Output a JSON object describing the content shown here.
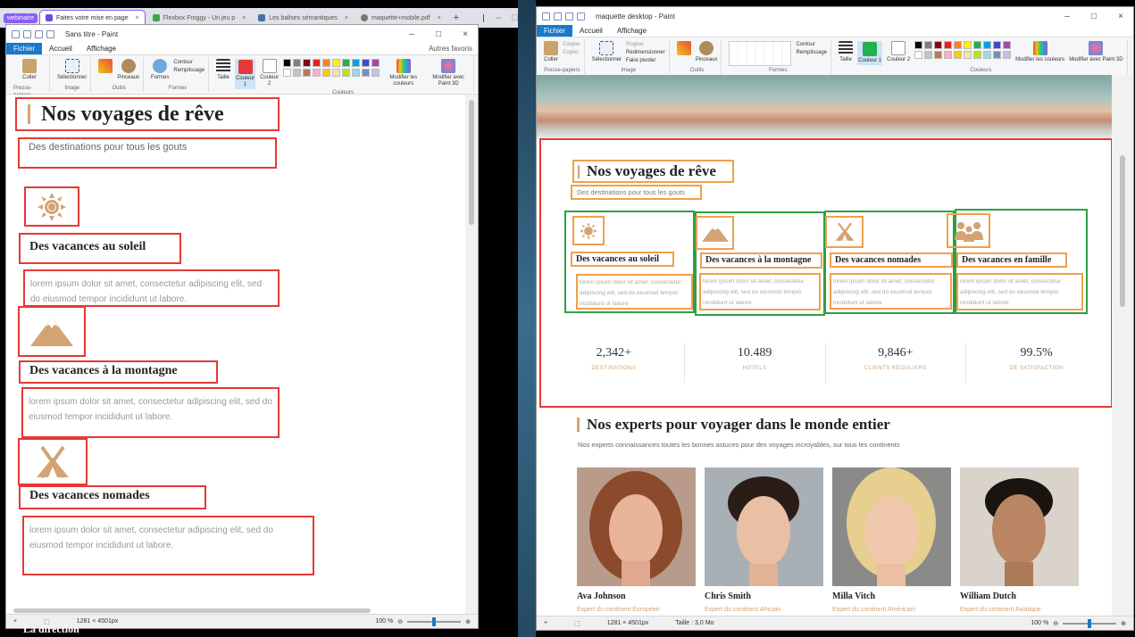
{
  "left": {
    "browser_tabs": [
      {
        "label": "webinaire",
        "active": false
      },
      {
        "label": "Faites votre mise en page",
        "active": true
      },
      {
        "label": "Flexbox Froggy - Un jeu p",
        "active": false
      },
      {
        "label": "Les balises sémantiques",
        "active": false
      },
      {
        "label": "maquette+mobile.pdf",
        "active": false
      }
    ],
    "window_title": "Sans titre - Paint",
    "menu": [
      "Fichier",
      "Accueil",
      "Affichage"
    ],
    "ribbon_groups": [
      "Presse-papiers",
      "Image",
      "Outils",
      "Formes",
      "Couleurs"
    ],
    "ribbon_items": {
      "coller": "Coller",
      "selectionner": "Sélectionner",
      "pinceaux": "Pinceaux",
      "formes": "Formes",
      "contour": "Contour",
      "remplissage": "Remplissage",
      "taille": "Taille",
      "couleur1": "Couleur 1",
      "couleur2": "Couleur 2",
      "modifier_couleurs": "Modifier les couleurs",
      "paint3d": "Modifier avec Paint 3D"
    },
    "bookmark": "Autres favoris",
    "canvas": {
      "title": "Nos voyages de rêve",
      "subtitle": "Des destinations pour tous les gouts",
      "sections": [
        {
          "heading": "Des vacances au soleil",
          "icon": "sun-icon",
          "text": "lorem ipsum dolor sit amet, consectetur adipiscing elit, sed do eiusmod tempor incididunt ut labore."
        },
        {
          "heading": "Des vacances à la montagne",
          "icon": "mountain-icon",
          "text": "lorem ipsum dolor sit amet, consectetur adipiscing elit, sed do eiusmod tempor incididunt ut labore."
        },
        {
          "heading": "Des vacances nomades",
          "icon": "tent-icon",
          "text": "lorem ipsum dolor sit amet, consectetur adipiscing elit, sed do eiusmod tempor incididunt ut labore."
        }
      ]
    },
    "status": {
      "dimensions": "1281 × 4501px",
      "zoom": "100 %"
    }
  },
  "right": {
    "window_title": "maquette desktop - Paint",
    "menu": [
      "Fichier",
      "Accueil",
      "Affichage"
    ],
    "ribbon_groups": [
      "Presse-papiers",
      "Image",
      "Outils",
      "Formes",
      "Couleurs"
    ],
    "ribbon_items": {
      "coller": "Coller",
      "couper": "Couper",
      "copier": "Copier",
      "selectionner": "Sélectionner",
      "rogner": "Rogner",
      "redimensionner": "Redimensionner",
      "faire_pivoter": "Faire pivoter",
      "pinceaux": "Pinceaux",
      "contour": "Contour",
      "remplissage": "Remplissage",
      "taille": "Taille",
      "couleur1": "Couleur 1",
      "couleur2": "Couleur 2",
      "modifier_couleurs": "Modifier les couleurs",
      "paint3d": "Modifier avec Paint 3D"
    },
    "canvas": {
      "title": "Nos voyages de rêve",
      "subtitle": "Des destinations pour tous les gouts",
      "cards": [
        {
          "heading": "Des vacances au soleil",
          "icon": "sun-icon",
          "text": "lorem ipsum dolor sit amet, consectetur adipiscing elit, sed do eiusmod tempor incididunt ut labore"
        },
        {
          "heading": "Des vacances à la montagne",
          "icon": "mountain-icon",
          "text": "lorem ipsum dolor sit amet, consectetur adipiscing elit, sed do eiusmod tempor incididunt ut labore"
        },
        {
          "heading": "Des vacances nomades",
          "icon": "tent-icon",
          "text": "lorem ipsum dolor sit amet, consectetur adipiscing elit, sed do eiusmod tempor incididunt ut labore"
        },
        {
          "heading": "Des vacances en famille",
          "icon": "family-icon",
          "text": "lorem ipsum dolor sit amet, consectetur adipiscing elit, sed do eiusmod tempor incididunt ut labore"
        }
      ],
      "stats": [
        {
          "value": "2,342+",
          "label": "DESTINATIONS"
        },
        {
          "value": "10.489",
          "label": "HOTELS"
        },
        {
          "value": "9,846+",
          "label": "CLIENTS REGULIERS"
        },
        {
          "value": "99.5%",
          "label": "DE SATISFACTION"
        }
      ],
      "experts_title": "Nos experts pour voyager dans le monde entier",
      "experts_subtitle": "Nos experts connaissances toutes les bonnes astuces pour des voyages incroyables, sur tous les continents",
      "experts": [
        {
          "name": "Ava Johnson",
          "role": "Expert du continent Européen"
        },
        {
          "name": "Chris Smith",
          "role": "Expert du continent Africain"
        },
        {
          "name": "Milla Vitch",
          "role": "Expert du continent Américain"
        },
        {
          "name": "William Dutch",
          "role": "Expert du continent Asiatique"
        }
      ]
    },
    "status": {
      "dimensions": "1281 × 4501px",
      "size": "Taille : 3,0 Mo",
      "zoom": "100 %"
    }
  },
  "bottom_text": "La direction",
  "colors": {
    "accent_tan": "#d4a373",
    "red_box": "#e53935",
    "orange_box": "#f0a04b",
    "green_box": "#2ea043",
    "paint_blue": "#1979ca"
  }
}
